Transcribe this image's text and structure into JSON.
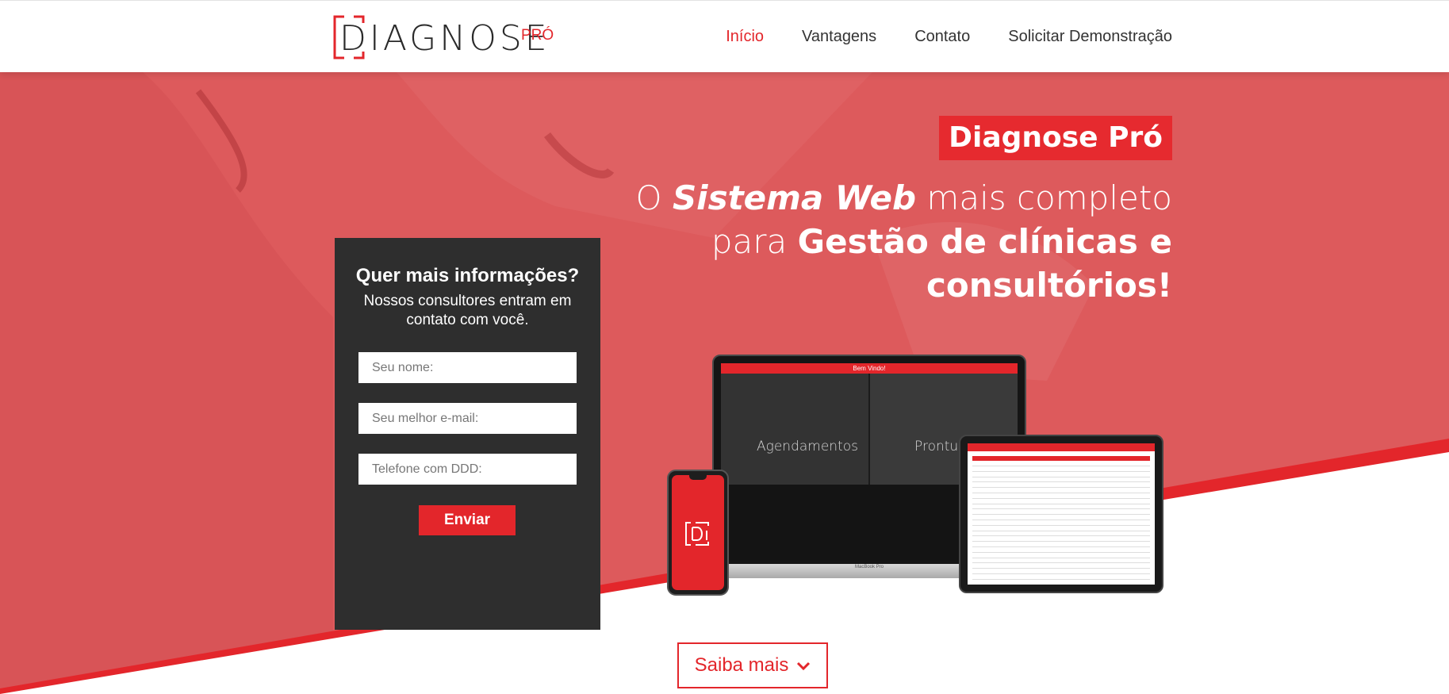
{
  "header": {
    "logo_text": "DIAGNOSE",
    "logo_suffix": "PRÓ",
    "nav": [
      {
        "label": "Início",
        "active": true
      },
      {
        "label": "Vantagens",
        "active": false
      },
      {
        "label": "Contato",
        "active": false
      },
      {
        "label": "Solicitar Demonstração",
        "active": false
      }
    ]
  },
  "hero": {
    "brand_badge": "Diagnose Pró",
    "headline": {
      "part1": "O ",
      "italic": "Sistema Web",
      "part2": " mais completo para ",
      "bold": "Gestão de clínicas e consultórios!"
    }
  },
  "form": {
    "title": "Quer mais informações?",
    "subtitle": "Nossos consultores entram em contato com você.",
    "name_placeholder": "Seu nome:",
    "email_placeholder": "Seu melhor e-mail:",
    "phone_placeholder": "Telefone com DDD:",
    "submit_label": "Enviar"
  },
  "devices": {
    "laptop_welcome": "Bem Vindo!",
    "laptop_tile_1": "Agendamentos",
    "laptop_tile_2": "Prontuários",
    "laptop_model": "MacBook Pro"
  },
  "cta": {
    "label": "Saiba mais"
  },
  "colors": {
    "accent": "#e3262b",
    "hero_overlay": "#dd5a5c",
    "form_bg": "#2e2e2e",
    "nav_text": "#333333"
  },
  "icons": {
    "cta_icon": "chevron-down-icon"
  }
}
